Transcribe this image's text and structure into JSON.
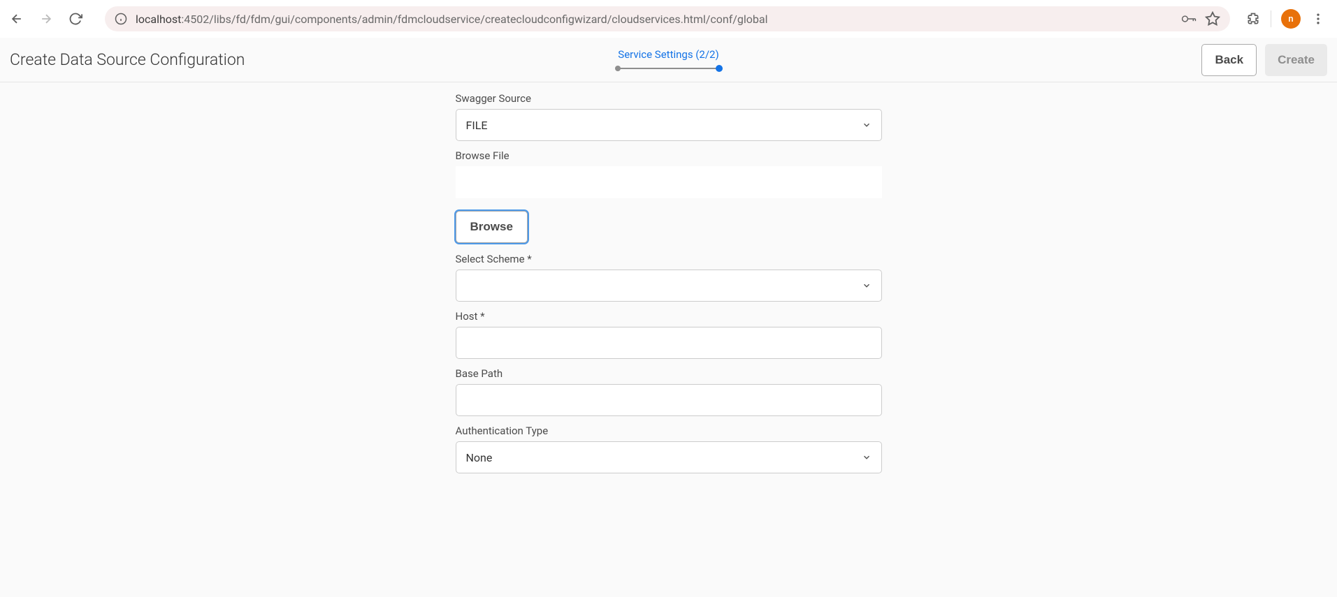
{
  "browser": {
    "url_host": "localhost",
    "url_port": ":4502",
    "url_path": "/libs/fd/fdm/gui/components/admin/fdmcloudservice/createcloudconfigwizard/cloudservices.html/conf/global",
    "avatar_letter": "n"
  },
  "header": {
    "title": "Create Data Source Configuration",
    "wizard_label": "Service Settings (2/2)",
    "back_btn": "Back",
    "create_btn": "Create"
  },
  "form": {
    "swagger_source_label": "Swagger Source",
    "swagger_source_value": "FILE",
    "browse_file_label": "Browse File",
    "browse_file_value": "",
    "browse_btn": "Browse",
    "select_scheme_label": "Select Scheme *",
    "select_scheme_value": "",
    "host_label": "Host *",
    "host_value": "",
    "base_path_label": "Base Path",
    "base_path_value": "",
    "auth_type_label": "Authentication Type",
    "auth_type_value": "None"
  }
}
